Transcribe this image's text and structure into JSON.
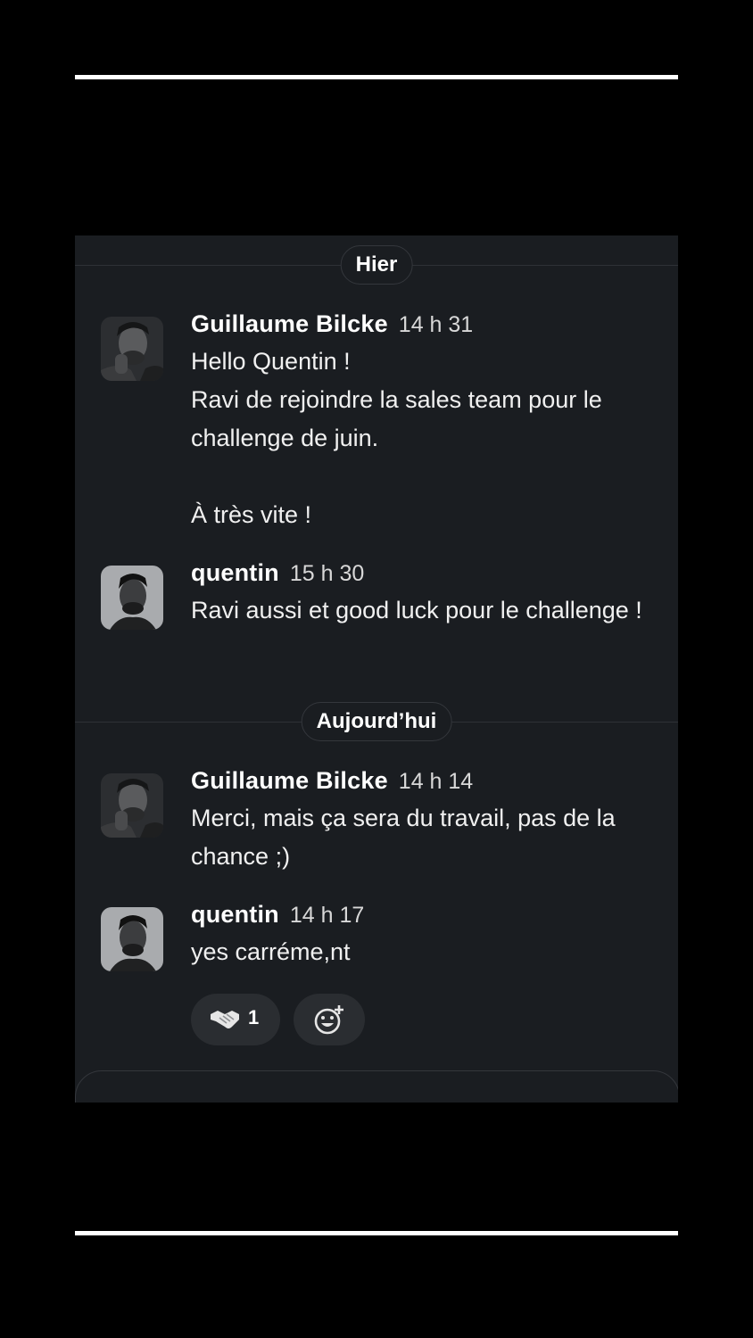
{
  "messages": {
    "day1_label": "Hier",
    "day2_label": "Aujourd’hui",
    "m1": {
      "author": "Guillaume Bilcke",
      "time": "14 h 31",
      "text": "Hello Quentin !\nRavi de rejoindre la sales team pour le challenge de juin.\n\nÀ très vite !"
    },
    "m2": {
      "author": "quentin",
      "time": "15 h 30",
      "text": "Ravi aussi et good luck pour le challenge !"
    },
    "m3": {
      "author": "Guillaume Bilcke",
      "time": "14 h 14",
      "text": "Merci, mais ça sera du travail, pas de la chance ;)"
    },
    "m4": {
      "author": "quentin",
      "time": "14 h 17",
      "text": "yes carréme,nt"
    }
  },
  "reactions": {
    "handshake": {
      "icon": "handshake-icon",
      "count": "1"
    },
    "add": {
      "icon": "add-reaction-icon"
    }
  },
  "colors": {
    "background": "#1a1d21",
    "pill_border": "#34373c",
    "reaction_bg": "#2a2d31"
  }
}
